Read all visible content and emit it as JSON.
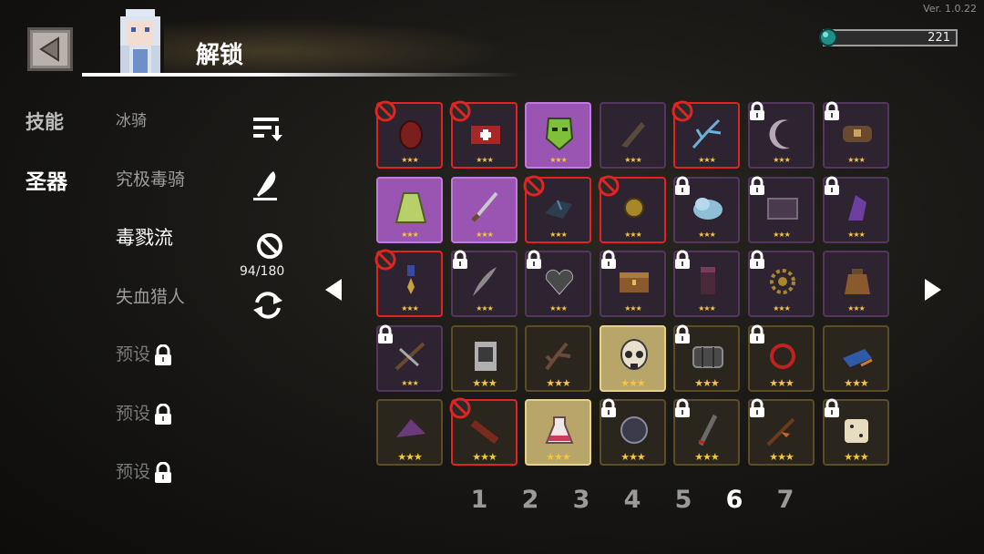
{
  "version": "Ver. 1.0.22",
  "header": {
    "title": "解锁",
    "currency_value": "221"
  },
  "categories": [
    {
      "label": "技能",
      "active": false
    },
    {
      "label": "圣器",
      "active": true
    }
  ],
  "presets": [
    {
      "label": "冰骑",
      "state": "dim"
    },
    {
      "label": "究极毒骑",
      "state": "dim"
    },
    {
      "label": "毒戮流",
      "state": "active"
    },
    {
      "label": "失血猎人",
      "state": "dim"
    },
    {
      "label": "预设",
      "state": "locked"
    },
    {
      "label": "预设",
      "state": "locked"
    },
    {
      "label": "预设",
      "state": "locked"
    }
  ],
  "tools": {
    "count": "94/180"
  },
  "items": [
    {
      "rarity": "purple",
      "status": "banned",
      "icon": "red-egg-icon",
      "stars": 3
    },
    {
      "rarity": "purple",
      "status": "banned",
      "icon": "medkit-icon",
      "stars": 3
    },
    {
      "rarity": "purple",
      "status": "selected",
      "icon": "green-mask-icon",
      "stars": 3
    },
    {
      "rarity": "purple",
      "status": "normal",
      "icon": "fossil-claw-icon",
      "stars": 3
    },
    {
      "rarity": "purple",
      "status": "banned",
      "icon": "ice-branch-icon",
      "stars": 3
    },
    {
      "rarity": "purple",
      "status": "locked",
      "icon": "moon-icon",
      "stars": 3
    },
    {
      "rarity": "purple",
      "status": "locked",
      "icon": "belt-bag-icon",
      "stars": 3
    },
    {
      "rarity": "purple",
      "status": "selected",
      "icon": "green-cloak-icon",
      "stars": 3
    },
    {
      "rarity": "purple",
      "status": "selected",
      "icon": "dagger-icon",
      "stars": 3
    },
    {
      "rarity": "purple",
      "status": "banned",
      "icon": "dark-shard-icon",
      "stars": 3
    },
    {
      "rarity": "purple",
      "status": "banned",
      "icon": "gold-orb-icon",
      "stars": 3
    },
    {
      "rarity": "purple",
      "status": "locked",
      "icon": "cloud-icon",
      "stars": 3
    },
    {
      "rarity": "purple",
      "status": "locked",
      "icon": "ornate-chest-icon",
      "stars": 3
    },
    {
      "rarity": "purple",
      "status": "locked",
      "icon": "purple-crystal-icon",
      "stars": 3
    },
    {
      "rarity": "purple",
      "status": "banned",
      "icon": "medal-icon",
      "stars": 3
    },
    {
      "rarity": "purple",
      "status": "locked",
      "icon": "feather-icon",
      "stars": 3
    },
    {
      "rarity": "purple",
      "status": "locked",
      "icon": "dark-heart-icon",
      "stars": 3
    },
    {
      "rarity": "purple",
      "status": "locked",
      "icon": "treasure-chest-icon",
      "stars": 3
    },
    {
      "rarity": "purple",
      "status": "locked",
      "icon": "gauntlet-icon",
      "stars": 3
    },
    {
      "rarity": "purple",
      "status": "locked",
      "icon": "gear-icon",
      "stars": 3
    },
    {
      "rarity": "purple",
      "status": "normal",
      "icon": "pouch-icon",
      "stars": 3
    },
    {
      "rarity": "purple",
      "status": "locked",
      "icon": "crossbow-icon",
      "stars": 3
    },
    {
      "rarity": "gold",
      "status": "normal",
      "icon": "scroll-icon",
      "stars": 3
    },
    {
      "rarity": "gold",
      "status": "normal",
      "icon": "antler-icon",
      "stars": 3
    },
    {
      "rarity": "gold",
      "status": "selected",
      "icon": "skull-icon",
      "stars": 3
    },
    {
      "rarity": "gold",
      "status": "locked",
      "icon": "drum-icon",
      "stars": 3
    },
    {
      "rarity": "gold",
      "status": "locked",
      "icon": "red-ring-icon",
      "stars": 3
    },
    {
      "rarity": "gold",
      "status": "normal",
      "icon": "blue-book-icon",
      "stars": 3
    },
    {
      "rarity": "gold",
      "status": "normal",
      "icon": "purple-hat-icon",
      "stars": 3
    },
    {
      "rarity": "gold",
      "status": "banned",
      "icon": "red-arm-icon",
      "stars": 3
    },
    {
      "rarity": "gold",
      "status": "selected",
      "icon": "potion-icon",
      "stars": 3
    },
    {
      "rarity": "gold",
      "status": "locked",
      "icon": "dark-orb-icon",
      "stars": 3
    },
    {
      "rarity": "gold",
      "status": "locked",
      "icon": "blade-icon",
      "stars": 3
    },
    {
      "rarity": "gold",
      "status": "locked",
      "icon": "fire-branch-icon",
      "stars": 3
    },
    {
      "rarity": "gold",
      "status": "locked",
      "icon": "dice-icon",
      "stars": 3
    }
  ],
  "pagination": {
    "pages": [
      "1",
      "2",
      "3",
      "4",
      "5",
      "6",
      "7"
    ],
    "current": "6"
  },
  "colors": {
    "banned": "#e02424",
    "selected_purple": "#9a55b2",
    "selected_gold": "#b7a56a",
    "star": "#f4c542"
  }
}
